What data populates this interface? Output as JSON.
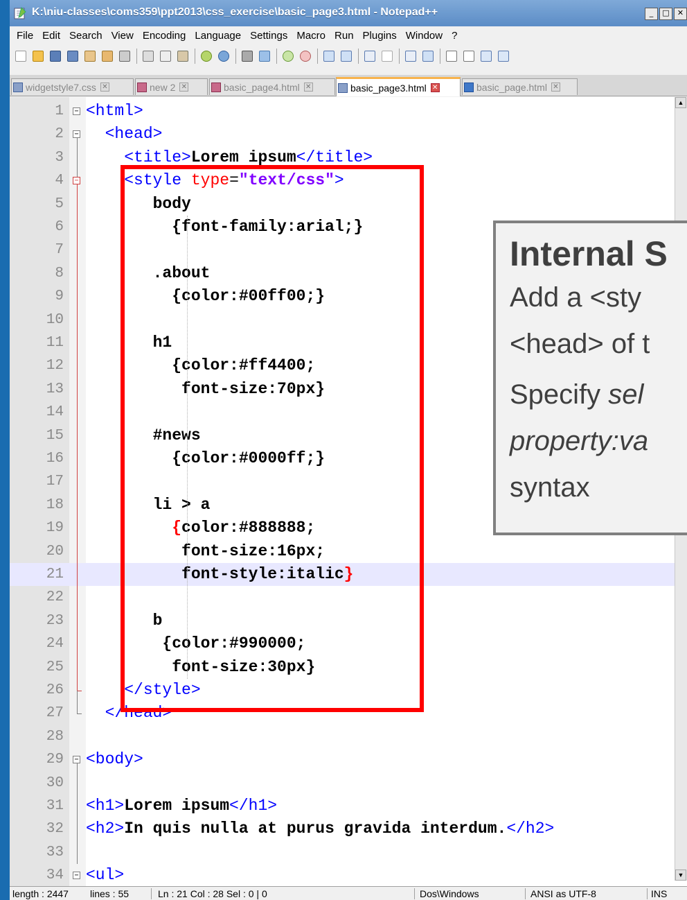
{
  "window": {
    "title": "K:\\niu-classes\\coms359\\ppt2013\\css_exercise\\basic_page3.html - Notepad++",
    "controls": {
      "minimize": "_",
      "maximize": "□",
      "close": "✕"
    }
  },
  "menubar": [
    "File",
    "Edit",
    "Search",
    "View",
    "Encoding",
    "Language",
    "Settings",
    "Macro",
    "Run",
    "Plugins",
    "Window",
    "?"
  ],
  "tabs": [
    {
      "label": "widgetstyle7.css",
      "active": false
    },
    {
      "label": "new  2",
      "active": false
    },
    {
      "label": "basic_page4.html",
      "active": false
    },
    {
      "label": "basic_page3.html",
      "active": true
    },
    {
      "label": "basic_page.html",
      "active": false
    }
  ],
  "editor": {
    "current_line": 21,
    "lines": [
      {
        "n": "1",
        "html": "<span class=\"tag\">&lt;html&gt;</span>"
      },
      {
        "n": "2",
        "html": "  <span class=\"tag\">&lt;head&gt;</span>"
      },
      {
        "n": "3",
        "html": "    <span class=\"tag\">&lt;title&gt;</span><span class=\"b\">Lorem ipsum</span><span class=\"tag\">&lt;/title&gt;</span>"
      },
      {
        "n": "4",
        "html": "    <span class=\"tag\">&lt;style</span> <span class=\"attr\">type</span>=<span class=\"str\">\"text/css\"</span><span class=\"tag\">&gt;</span>"
      },
      {
        "n": "5",
        "html": "       <span class=\"b\">body</span>"
      },
      {
        "n": "6",
        "html": "         <span class=\"b\">{font-family:arial;}</span>"
      },
      {
        "n": "7",
        "html": ""
      },
      {
        "n": "8",
        "html": "       <span class=\"b\">.about</span>"
      },
      {
        "n": "9",
        "html": "         <span class=\"b\">{color:#00ff00;}</span>"
      },
      {
        "n": "10",
        "html": ""
      },
      {
        "n": "11",
        "html": "       <span class=\"b\">h1</span>"
      },
      {
        "n": "12",
        "html": "         <span class=\"b\">{color:#ff4400;</span>"
      },
      {
        "n": "13",
        "html": "          <span class=\"b\">font-size:70px}</span>"
      },
      {
        "n": "14",
        "html": ""
      },
      {
        "n": "15",
        "html": "       <span class=\"b\">#news</span>"
      },
      {
        "n": "16",
        "html": "         <span class=\"b\">{color:#0000ff;}</span>"
      },
      {
        "n": "17",
        "html": ""
      },
      {
        "n": "18",
        "html": "       <span class=\"b\">li &gt; a</span>"
      },
      {
        "n": "19",
        "html": "         <span class=\"brace\">{</span><span class=\"b\">color:#888888;</span>"
      },
      {
        "n": "20",
        "html": "          <span class=\"b\">font-size:16px;</span>"
      },
      {
        "n": "21",
        "html": "          <span class=\"b\">font-style:italic</span><span class=\"brace\">}</span>"
      },
      {
        "n": "22",
        "html": ""
      },
      {
        "n": "23",
        "html": "       <span class=\"b\">b</span>"
      },
      {
        "n": "24",
        "html": "        <span class=\"b\">{color:#990000;</span>"
      },
      {
        "n": "25",
        "html": "         <span class=\"b\">font-size:30px}</span>"
      },
      {
        "n": "26",
        "html": "    <span class=\"tag\">&lt;/style&gt;</span>"
      },
      {
        "n": "27",
        "html": "  <span class=\"tag\">&lt;/head&gt;</span>"
      },
      {
        "n": "28",
        "html": ""
      },
      {
        "n": "29",
        "html": "<span class=\"tag\">&lt;body&gt;</span>"
      },
      {
        "n": "30",
        "html": ""
      },
      {
        "n": "31",
        "html": "<span class=\"tag\">&lt;h1&gt;</span><span class=\"b\">Lorem ipsum</span><span class=\"tag\">&lt;/h1&gt;</span>"
      },
      {
        "n": "32",
        "html": "<span class=\"tag\">&lt;h2&gt;</span><span class=\"b\">In quis nulla at purus gravida interdum.</span><span class=\"tag\">&lt;/h2&gt;</span>"
      },
      {
        "n": "33",
        "html": ""
      },
      {
        "n": "34",
        "html": "<span class=\"tag\">&lt;ul&gt;</span>"
      }
    ]
  },
  "callout": {
    "title": "Internal S",
    "line1": "Add a <sty",
    "line2": "<head> of t",
    "line3_plain": "Specify ",
    "line3_em": "sel",
    "line4_em": "property:va",
    "line5": "syntax"
  },
  "status": {
    "length": "length : 2447",
    "lines": "lines : 55",
    "position": "Ln : 21    Col : 28    Sel : 0 | 0",
    "eol": "Dos\\Windows",
    "encoding": "ANSI as UTF-8",
    "mode": "INS"
  },
  "colors": {
    "highlight_box": "#ff0000",
    "background": "#1a6cb0",
    "current_line": "#e8e8ff"
  }
}
